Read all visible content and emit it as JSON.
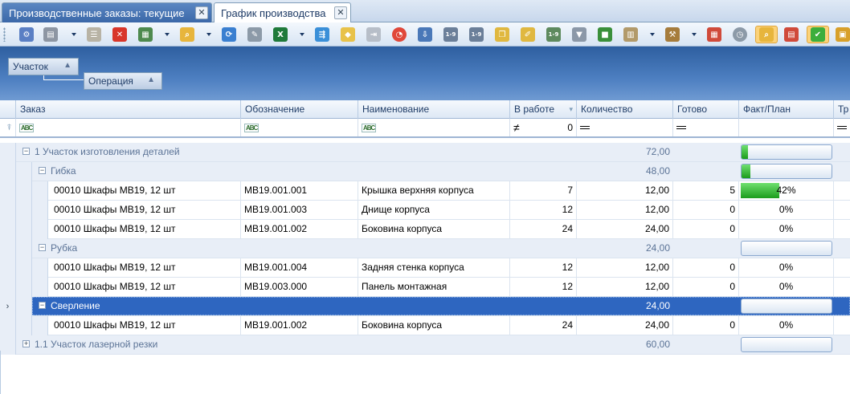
{
  "tabs": [
    {
      "label": "Производственные заказы: текущие"
    },
    {
      "label": "График производства"
    }
  ],
  "toolbar": {
    "icons": [
      "settings-icon",
      "print-icon",
      "list-icon",
      "delete-icon",
      "chart-icon",
      "search-icon",
      "refresh-icon",
      "wrench-icon",
      "excel-icon",
      "share-icon",
      "tag-icon",
      "skip-icon",
      "pie-icon",
      "download-icon",
      "range-icon",
      "range-icon",
      "docs-icon",
      "edit-icon",
      "range-icon",
      "filter-icon",
      "shapes-icon",
      "clipboard-icon",
      "hammer-icon",
      "calendar-icon",
      "timer-icon",
      "zoom-icon",
      "calendar-icon",
      "check-icon",
      "package-icon"
    ]
  },
  "group_panel": {
    "level1": "Участок",
    "level2": "Операция"
  },
  "columns": {
    "order": "Заказ",
    "designation": "Обозначение",
    "name": "Наименование",
    "in_work": "В работе",
    "quantity": "Количество",
    "done": "Готово",
    "fact_plan": "Факт/План",
    "extra": "Тр"
  },
  "filters": {
    "in_work_op": "≠",
    "in_work_value": "0"
  },
  "groups": {
    "g1": {
      "label": "1 Участок изготовления деталей",
      "quantity": "72,00",
      "progress": 0.02
    },
    "g1a": {
      "label": "Гибка",
      "quantity": "48,00",
      "progress": 0.1
    },
    "g1b": {
      "label": "Рубка",
      "quantity": "24,00",
      "progress": 0
    },
    "g1c": {
      "label": "Сверление",
      "quantity": "24,00",
      "progress": 0
    },
    "g2": {
      "label": "1.1 Участок лазерной резки",
      "quantity": "60,00",
      "progress": 0
    }
  },
  "rows": [
    {
      "order": "00010 Шкафы МВ19, 12 шт",
      "designation": "МВ19.001.001",
      "name": "Крышка верхняя корпуса",
      "in_work": "7",
      "quantity": "12,00",
      "done": "5",
      "pct": "42%",
      "progress": 0.42
    },
    {
      "order": "00010 Шкафы МВ19, 12 шт",
      "designation": "МВ19.001.003",
      "name": "Днище корпуса",
      "in_work": "12",
      "quantity": "12,00",
      "done": "0",
      "pct": "0%",
      "progress": 0
    },
    {
      "order": "00010 Шкафы МВ19, 12 шт",
      "designation": "МВ19.001.002",
      "name": "Боковина корпуса",
      "in_work": "24",
      "quantity": "24,00",
      "done": "0",
      "pct": "0%",
      "progress": 0
    },
    {
      "order": "00010 Шкафы МВ19, 12 шт",
      "designation": "МВ19.001.004",
      "name": "Задняя стенка корпуса",
      "in_work": "12",
      "quantity": "12,00",
      "done": "0",
      "pct": "0%",
      "progress": 0
    },
    {
      "order": "00010 Шкафы МВ19, 12 шт",
      "designation": "МВ19.003.000",
      "name": "Панель монтажная",
      "in_work": "12",
      "quantity": "12,00",
      "done": "0",
      "pct": "0%",
      "progress": 0
    },
    {
      "order": "00010 Шкафы МВ19, 12 шт",
      "designation": "МВ19.001.002",
      "name": "Боковина корпуса",
      "in_work": "24",
      "quantity": "24,00",
      "done": "0",
      "pct": "0%",
      "progress": 0
    }
  ],
  "colors": {
    "accent": "#2e66c0",
    "progress": "#1c9c1c",
    "group_text": "#5b7396"
  }
}
